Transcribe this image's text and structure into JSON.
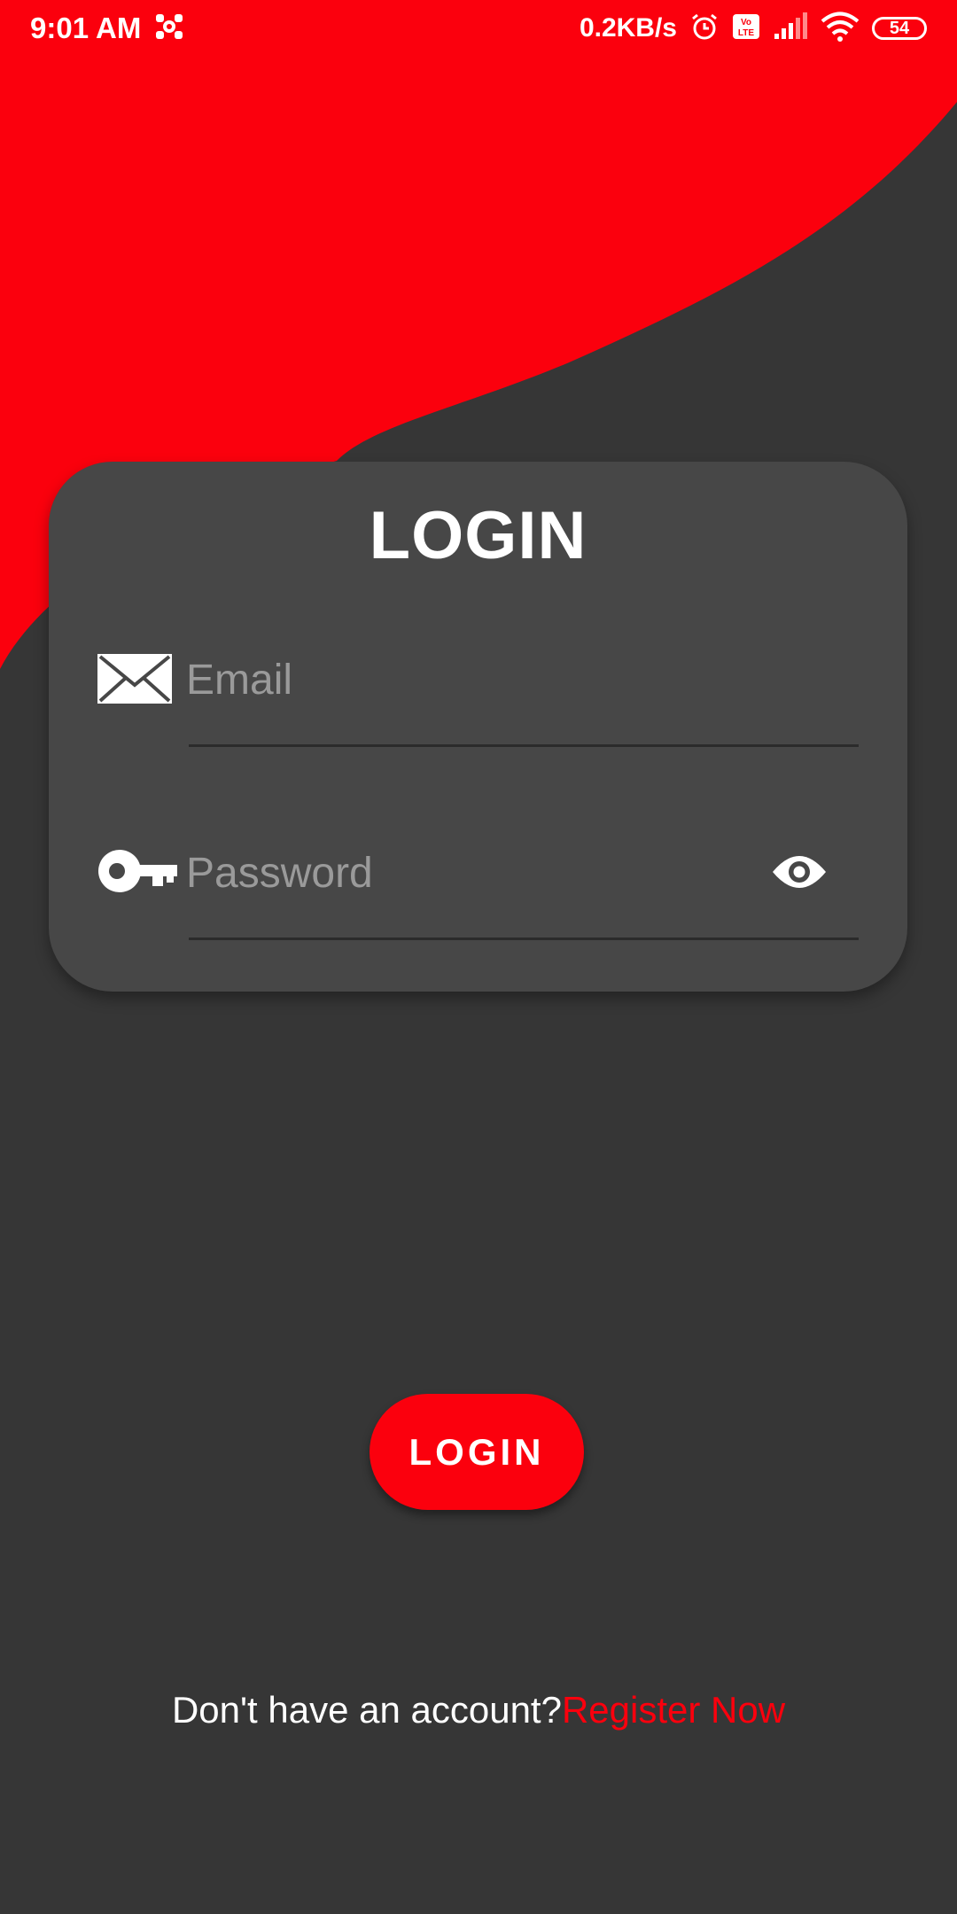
{
  "status_bar": {
    "time": "9:01 AM",
    "network_speed": "0.2KB/s",
    "battery_level": "54",
    "icons": [
      "app-notification-icon",
      "alarm-icon",
      "volte-icon",
      "signal-icon",
      "wifi-icon",
      "battery-icon"
    ]
  },
  "colors": {
    "accent": "#fb000d",
    "background": "#363636",
    "card": "#474747"
  },
  "login_card": {
    "title": "LOGIN",
    "email": {
      "placeholder": "Email",
      "value": "",
      "icon": "envelope-icon"
    },
    "password": {
      "placeholder": "Password",
      "value": "",
      "icon": "key-icon",
      "toggle_icon": "eye-icon"
    }
  },
  "login_button": {
    "label": "LOGIN"
  },
  "register": {
    "prompt": "Don't have an account?",
    "link": "Register Now"
  }
}
